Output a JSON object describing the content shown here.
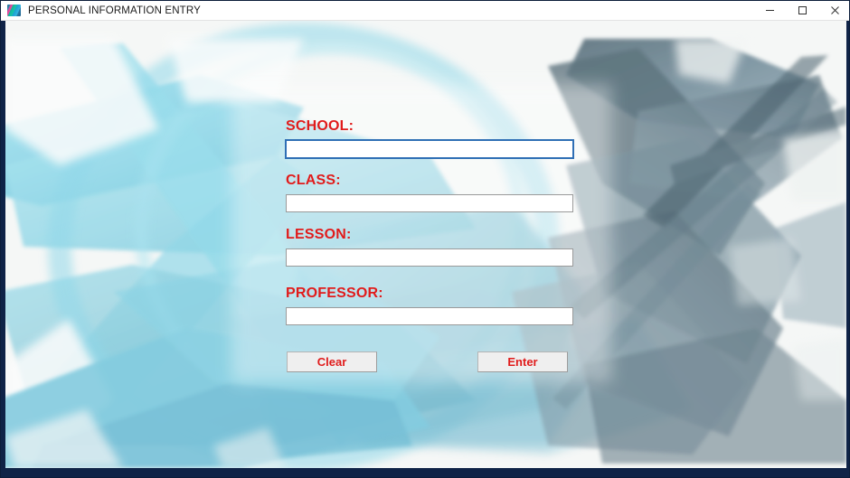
{
  "window": {
    "title": "PERSONAL INFORMATION ENTRY",
    "icon": "app-logo-icon",
    "border_color": "#0f2347",
    "titlebar_bg": "#ffffff",
    "controls": {
      "minimize_label": "Minimize",
      "maximize_label": "Maximize",
      "close_label": "Close"
    }
  },
  "background": {
    "style": "abstract-brush-painting",
    "canvas_color": "#f4f6f5",
    "accent_light": "#8fdcec",
    "accent_mid": "#69b8ce",
    "accent_dark": "#3d5a68",
    "accent_slate": "#5b7b8c"
  },
  "form": {
    "label_color": "#e01b1b",
    "fields": [
      {
        "name": "school",
        "label": "SCHOOL:",
        "value": "",
        "placeholder": "",
        "focused": true
      },
      {
        "name": "class",
        "label": "CLASS:",
        "value": "",
        "placeholder": "",
        "focused": false
      },
      {
        "name": "lesson",
        "label": "LESSON:",
        "value": "",
        "placeholder": "",
        "focused": false
      },
      {
        "name": "professor",
        "label": "PROFESSOR:",
        "value": "",
        "placeholder": "",
        "focused": false
      }
    ],
    "buttons": {
      "clear_label": "Clear",
      "enter_label": "Enter"
    }
  }
}
